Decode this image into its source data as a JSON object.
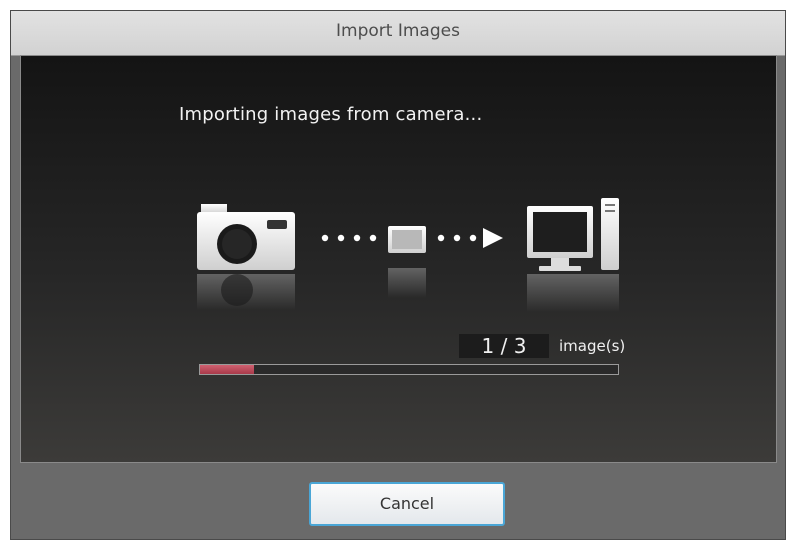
{
  "window": {
    "title": "Import Images"
  },
  "status": {
    "message": "Importing images from camera...",
    "current": 1,
    "total": 3,
    "counter_text": "1 / 3",
    "unit_label": "image(s)",
    "progress_fraction": 0.13
  },
  "buttons": {
    "cancel_label": "Cancel"
  },
  "icons": [
    "camera-icon",
    "image-thumbnail-icon",
    "arrow-right-icon",
    "computer-icon"
  ],
  "colors": {
    "progress_fill": "#b84454",
    "button_border": "#4aa6d6"
  }
}
